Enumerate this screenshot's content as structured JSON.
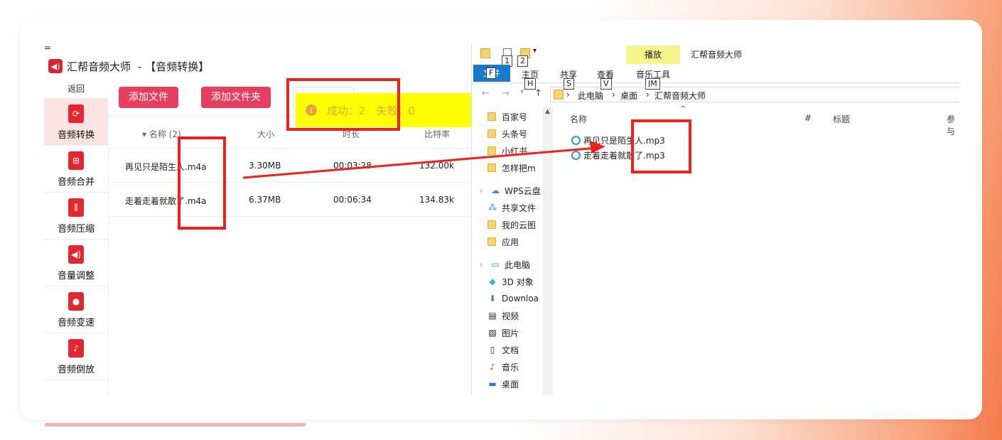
{
  "app": {
    "menu_glyph": "=",
    "title": "汇帮音频大师",
    "subtitle": "- 【音频转换】",
    "back_label": "返回",
    "sidebar": [
      {
        "label": "音频转换",
        "icon": "convert-icon",
        "active": true
      },
      {
        "label": "音频合并",
        "icon": "merge-icon",
        "active": false
      },
      {
        "label": "音频压缩",
        "icon": "compress-icon",
        "active": false
      },
      {
        "label": "音量调整",
        "icon": "volume-icon",
        "active": false
      },
      {
        "label": "音频变速",
        "icon": "mic-icon",
        "active": false
      },
      {
        "label": "音频倒放",
        "icon": "music-note-icon",
        "active": false
      }
    ],
    "toolbar": {
      "add_file": "添加文件",
      "add_folder": "添加文件夹"
    },
    "toast": {
      "text": "成功：2　失败：0",
      "icon": "info-icon"
    },
    "table": {
      "headers": [
        "名称 (2)",
        "大小",
        "时长",
        "比特率"
      ],
      "rows": [
        {
          "name": "再见只是陌生人.m4a",
          "size": "3.30MB",
          "duration": "00:03:28",
          "bitrate": "132.00k"
        },
        {
          "name": "走着走着就散了.m4a",
          "size": "6.37MB",
          "duration": "00:06:34",
          "bitrate": "134.83k"
        }
      ]
    }
  },
  "explorer": {
    "window_title": "汇帮音频大师",
    "ribbon_context_tab": "播放",
    "tabs": {
      "file": "文件",
      "home": "主页",
      "share": "共享",
      "view": "查看",
      "music_tools": "音乐工具"
    },
    "keytips": {
      "file": "F",
      "qa1": "1",
      "qa2": "2",
      "home": "H",
      "share": "S",
      "view": "V",
      "music": "JM"
    },
    "breadcrumb": [
      "此电脑",
      "桌面",
      "汇帮音频大师"
    ],
    "nav": [
      {
        "label": "百家号",
        "icon": "folder-icon"
      },
      {
        "label": "头条号",
        "icon": "folder-icon"
      },
      {
        "label": "小红书",
        "icon": "folder-icon"
      },
      {
        "label": "怎样把m",
        "icon": "folder-icon"
      },
      {
        "label": "WPS云盘",
        "icon": "cloud-icon"
      },
      {
        "label": "共享文件",
        "icon": "share-icon"
      },
      {
        "label": "我的云图",
        "icon": "folder-icon"
      },
      {
        "label": "应用",
        "icon": "folder-icon"
      },
      {
        "label": "此电脑",
        "icon": "computer-icon"
      },
      {
        "label": "3D 对象",
        "icon": "cube-icon"
      },
      {
        "label": "Downloa",
        "icon": "download-icon"
      },
      {
        "label": "视频",
        "icon": "video-icon"
      },
      {
        "label": "图片",
        "icon": "picture-icon"
      },
      {
        "label": "文档",
        "icon": "document-icon"
      },
      {
        "label": "音乐",
        "icon": "music-icon"
      },
      {
        "label": "桌面",
        "icon": "desktop-icon"
      }
    ],
    "columns": [
      "名称",
      "#",
      "标题",
      "参与"
    ],
    "files": [
      "再见只是陌生人.mp3",
      "走着走着就散了.mp3"
    ]
  }
}
